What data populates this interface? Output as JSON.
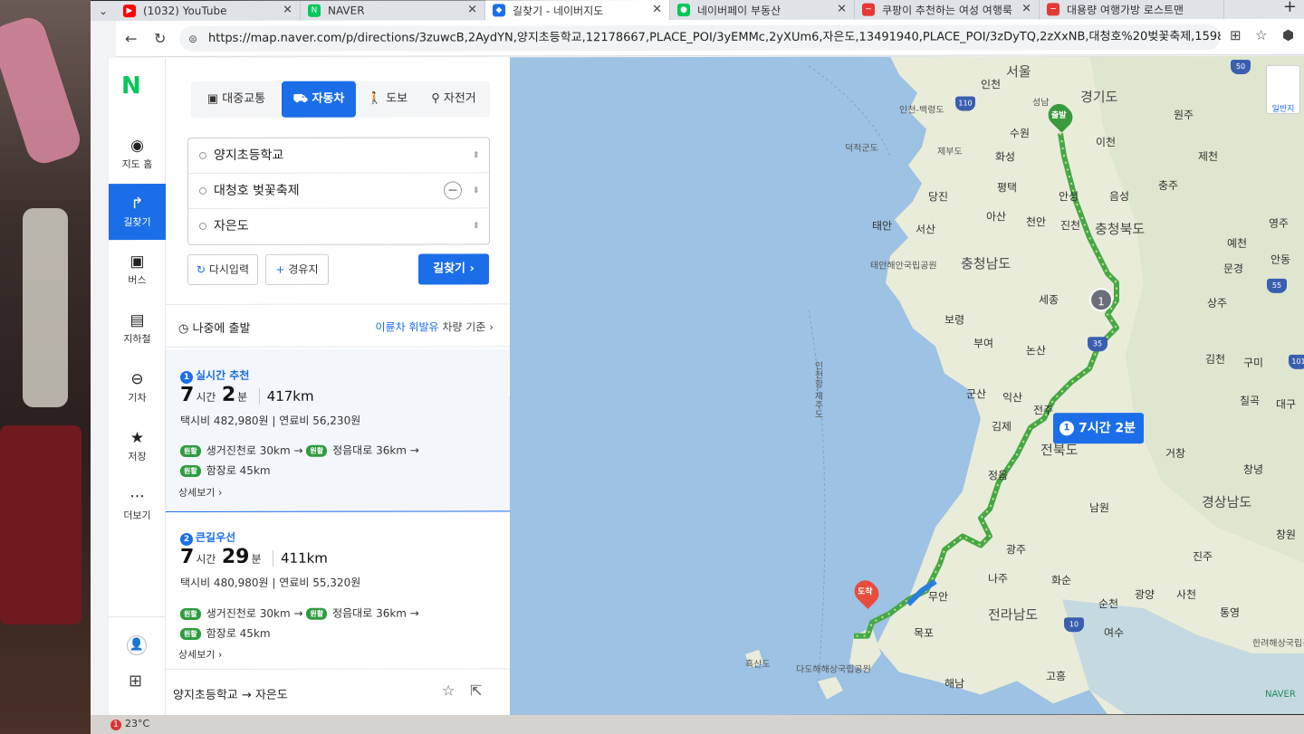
{
  "browser": {
    "tabs": [
      {
        "title": "(1032) YouTube",
        "icon": "youtube-icon",
        "color": "#ff0000"
      },
      {
        "title": "NAVER",
        "icon": "naver-icon",
        "color": "#03c75a"
      },
      {
        "title": "길찾기 - 네이버지도",
        "icon": "naver-map-icon",
        "color": "#1b6ee8"
      },
      {
        "title": "네이버페이 부동산",
        "icon": "naver-pay-icon",
        "color": "#03c75a"
      },
      {
        "title": "쿠팡이 추천하는 여성 여행룩",
        "icon": "coupang-icon",
        "color": "#e53935"
      },
      {
        "title": "대용량 여행가방 로스트맨",
        "icon": "coupang-icon",
        "color": "#e53935"
      }
    ],
    "url": "https://map.naver.com/p/directions/3zuwcB,2AydYN,양지초등학교,12178667,PLACE_POI/3yEMMc,2yXUm6,자은도,13491940,PLACE_POI/3zDyTQ,2zXxNB,대청호%20벚꽃축제,15988..."
  },
  "rail": {
    "logo": "N",
    "items": [
      {
        "label": "지도 홈",
        "icon": "map-home-icon"
      },
      {
        "label": "길찾기",
        "icon": "directions-icon"
      },
      {
        "label": "버스",
        "icon": "bus-icon"
      },
      {
        "label": "지하철",
        "icon": "subway-icon"
      },
      {
        "label": "기차",
        "icon": "train-icon"
      },
      {
        "label": "저장",
        "icon": "star-icon"
      },
      {
        "label": "더보기",
        "icon": "more-icon"
      }
    ]
  },
  "panel": {
    "modes": [
      "대중교통",
      "자동차",
      "도보",
      "자전거"
    ],
    "waypoints": [
      "양지초등학교",
      "대청호 벚꽃축제",
      "자은도"
    ],
    "reset_label": "다시입력",
    "via_label": "경유지",
    "find_label": "길찾기",
    "depart_label": "나중에 출발",
    "fuel_link": "이륜차 휘발유",
    "fuel_suffix": "차량 기준",
    "routes": [
      {
        "num": "1",
        "tag": "실시간 추천",
        "hours": "7",
        "minutes": "2",
        "hour_unit": "시간",
        "minute_unit": "분",
        "distance": "417km",
        "taxi": "택시비 482,980원",
        "fuel": "연료비 56,230원",
        "roads": [
          "생거진천로 30km",
          "정음대로 36km",
          "함장로 45km"
        ],
        "badge": "원활",
        "more": "상세보기"
      },
      {
        "num": "2",
        "tag": "큰길우선",
        "hours": "7",
        "minutes": "29",
        "hour_unit": "시간",
        "minute_unit": "분",
        "distance": "411km",
        "taxi": "택시비 480,980원",
        "fuel": "연료비 55,320원",
        "roads": [
          "생거진천로 30km",
          "정음대로 36km",
          "함장로 45km"
        ],
        "badge": "원활",
        "more": "상세보기"
      }
    ],
    "footer": "양지초등학교 → 자은도"
  },
  "map": {
    "callout_num": "1",
    "callout_text": "7시간 2분",
    "start_label": "출발",
    "end_label": "도착",
    "waypoint_num": "1",
    "mapmode_label": "일반지",
    "labels": [
      {
        "text": "서울",
        "cls": "big"
      },
      {
        "text": "인천",
        "cls": ""
      },
      {
        "text": "경기도",
        "cls": "big"
      },
      {
        "text": "성남",
        "cls": "small"
      },
      {
        "text": "수원",
        "cls": ""
      },
      {
        "text": "이천",
        "cls": ""
      },
      {
        "text": "원주",
        "cls": ""
      },
      {
        "text": "화성",
        "cls": ""
      },
      {
        "text": "평택",
        "cls": ""
      },
      {
        "text": "안성",
        "cls": ""
      },
      {
        "text": "음성",
        "cls": ""
      },
      {
        "text": "충주",
        "cls": ""
      },
      {
        "text": "제천",
        "cls": ""
      },
      {
        "text": "당진",
        "cls": ""
      },
      {
        "text": "아산",
        "cls": ""
      },
      {
        "text": "천안",
        "cls": ""
      },
      {
        "text": "진천",
        "cls": ""
      },
      {
        "text": "충청북도",
        "cls": "big"
      },
      {
        "text": "서산",
        "cls": ""
      },
      {
        "text": "태안",
        "cls": ""
      },
      {
        "text": "충청남도",
        "cls": "big"
      },
      {
        "text": "세종",
        "cls": ""
      },
      {
        "text": "보령",
        "cls": ""
      },
      {
        "text": "부여",
        "cls": ""
      },
      {
        "text": "논산",
        "cls": ""
      },
      {
        "text": "군산",
        "cls": ""
      },
      {
        "text": "익산",
        "cls": ""
      },
      {
        "text": "김제",
        "cls": ""
      },
      {
        "text": "전주",
        "cls": ""
      },
      {
        "text": "전북도",
        "cls": "big"
      },
      {
        "text": "정읍",
        "cls": ""
      },
      {
        "text": "남원",
        "cls": ""
      },
      {
        "text": "광주",
        "cls": ""
      },
      {
        "text": "나주",
        "cls": ""
      },
      {
        "text": "화순",
        "cls": ""
      },
      {
        "text": "무안",
        "cls": ""
      },
      {
        "text": "목포",
        "cls": ""
      },
      {
        "text": "전라남도",
        "cls": "big"
      },
      {
        "text": "순천",
        "cls": ""
      },
      {
        "text": "광양",
        "cls": ""
      },
      {
        "text": "여수",
        "cls": ""
      },
      {
        "text": "해남",
        "cls": ""
      },
      {
        "text": "고흥",
        "cls": ""
      },
      {
        "text": "흑산도",
        "cls": "small"
      },
      {
        "text": "다도해해상국립공원",
        "cls": "small"
      },
      {
        "text": "덕적군도",
        "cls": "small"
      },
      {
        "text": "제부도",
        "cls": "small"
      },
      {
        "text": "태안해안국립공원",
        "cls": "small"
      },
      {
        "text": "영주",
        "cls": ""
      },
      {
        "text": "예천",
        "cls": ""
      },
      {
        "text": "문경",
        "cls": ""
      },
      {
        "text": "안동",
        "cls": ""
      },
      {
        "text": "상주",
        "cls": ""
      },
      {
        "text": "김천",
        "cls": ""
      },
      {
        "text": "구미",
        "cls": ""
      },
      {
        "text": "칠곡",
        "cls": ""
      },
      {
        "text": "대구",
        "cls": ""
      },
      {
        "text": "거창",
        "cls": ""
      },
      {
        "text": "창녕",
        "cls": ""
      },
      {
        "text": "경상남도",
        "cls": "big"
      },
      {
        "text": "창원",
        "cls": ""
      },
      {
        "text": "진주",
        "cls": ""
      },
      {
        "text": "사천",
        "cls": ""
      },
      {
        "text": "통영",
        "cls": ""
      },
      {
        "text": "한려해상국립공원",
        "cls": "small"
      },
      {
        "text": "인천-백령도",
        "cls": "small"
      },
      {
        "text": "인천항-제주도",
        "cls": "small"
      },
      {
        "text": "NAVER",
        "cls": "small"
      }
    ]
  },
  "taskbar": {
    "weather": "23°C",
    "badge": "1"
  }
}
